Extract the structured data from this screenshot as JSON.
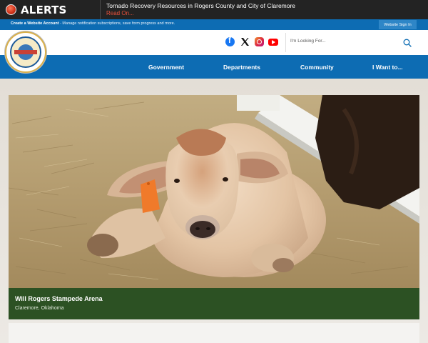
{
  "alerts": {
    "label": "ALERTS",
    "title": "Tornado Recovery Resources in Rogers County and City of Claremore",
    "read_on": "Read On..."
  },
  "account": {
    "link": "Create a Website Account",
    "text": " - Manage notification subscriptions, save form progress and more.",
    "sign_in": "Website Sign In"
  },
  "header": {
    "logo_text": "Rogers County Oklahoma",
    "search_placeholder": "I'm Looking For..."
  },
  "social": [
    "facebook-icon",
    "x-icon",
    "instagram-icon",
    "youtube-icon"
  ],
  "nav": {
    "items": [
      {
        "label": "Government"
      },
      {
        "label": "Departments"
      },
      {
        "label": "Community"
      },
      {
        "label": "I Want to..."
      }
    ]
  },
  "hero": {
    "title": "Will Rogers Stampede Arena",
    "subtitle": "Claremore, Oklahoma"
  },
  "colors": {
    "primary_blue": "#0d6cb3",
    "alerts_bg": "#232323",
    "caption_green": "#2c5123",
    "alert_red": "#e8503a"
  }
}
